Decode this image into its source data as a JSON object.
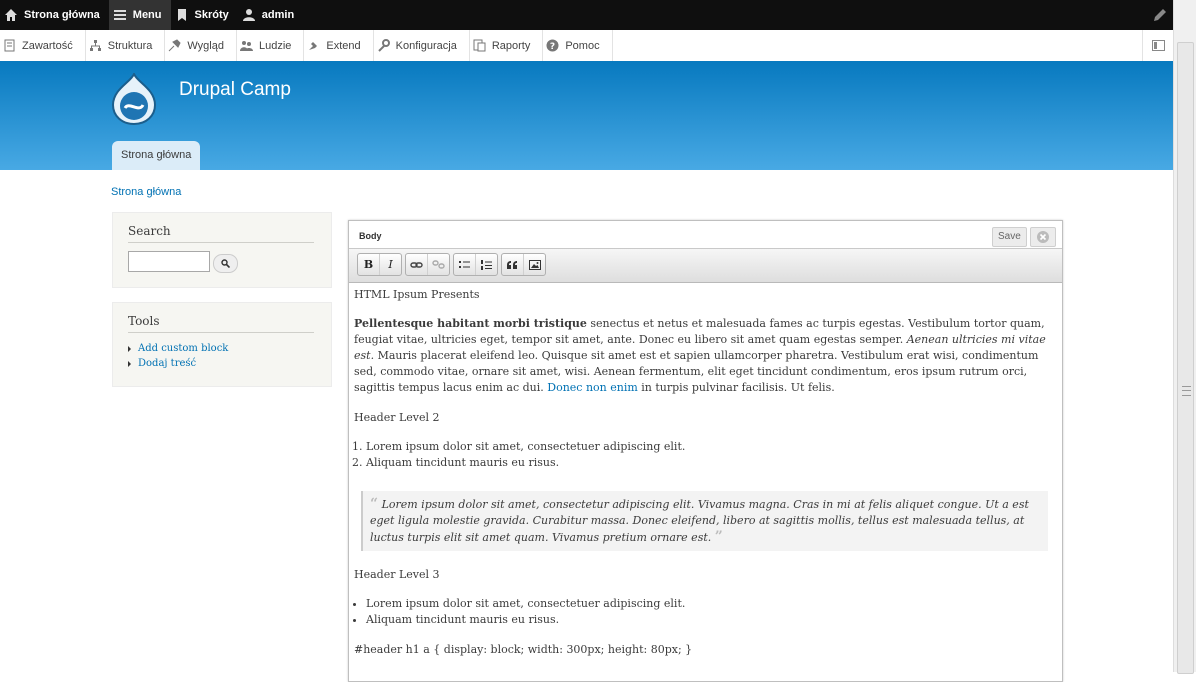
{
  "toolbar": {
    "home": "Strona główna",
    "menu": "Menu",
    "shortcuts": "Skróty",
    "user": "admin"
  },
  "tray": {
    "items": [
      "Zawartość",
      "Struktura",
      "Wygląd",
      "Ludzie",
      "Extend",
      "Konfiguracja",
      "Raporty",
      "Pomoc"
    ]
  },
  "site": {
    "name": "Drupal Camp",
    "tab": "Strona główna"
  },
  "breadcrumb": "Strona główna",
  "sidebar": {
    "search_title": "Search",
    "tools_title": "Tools",
    "tools_links": [
      "Add custom block",
      "Dodaj treść"
    ]
  },
  "editor": {
    "field_label": "Body",
    "save_label": "Save",
    "toolbar_buttons": [
      "B",
      "I"
    ],
    "content": {
      "p1": "HTML Ipsum Presents",
      "p2_bold": "Pellentesque habitant morbi tristique",
      "p2_text1": " senectus et netus et malesuada fames ac turpis egestas. Vestibulum tortor quam, feugiat vitae, ultricies eget, tempor sit amet, ante. Donec eu libero sit amet quam egestas semper. ",
      "p2_italic": "Aenean ultricies mi vitae est.",
      "p2_text2": " Mauris placerat eleifend leo. Quisque sit amet est et sapien ullamcorper pharetra. Vestibulum erat wisi, condimentum sed, commodo vitae, ornare sit amet, wisi. Aenean fermentum, elit eget tincidunt condimentum, eros ipsum rutrum orci, sagittis tempus lacus enim ac dui. ",
      "p2_link": "Donec non enim",
      "p2_text3": " in turpis pulvinar facilisis. Ut felis.",
      "h2": "Header Level 2",
      "ol": [
        "Lorem ipsum dolor sit amet, consectetuer adipiscing elit.",
        "Aliquam tincidunt mauris eu risus."
      ],
      "quote": "Lorem ipsum dolor sit amet, consectetur adipiscing elit. Vivamus magna. Cras in mi at felis aliquet congue. Ut a est eget ligula molestie gravida. Curabitur massa. Donec eleifend, libero at sagittis mollis, tellus est malesuada tellus, at luctus turpis elit sit amet quam. Vivamus pretium ornare est.",
      "h3": "Header Level 3",
      "ul": [
        "Lorem ipsum dolor sit amet, consectetuer adipiscing elit.",
        "Aliquam tincidunt mauris eu risus."
      ],
      "code": "#header h1 a { display: block; width: 300px; height: 80px; }"
    }
  },
  "colors": {
    "toolbar_bg": "#0f0f0f",
    "header_top": "#0779bf",
    "header_bottom": "#48a9e4",
    "link": "#0071b3"
  },
  "icons": [
    "home-icon",
    "menu-icon",
    "bookmark-icon",
    "user-icon",
    "pencil-icon",
    "content-icon",
    "structure-icon",
    "appearance-icon",
    "people-icon",
    "extend-icon",
    "config-icon",
    "reports-icon",
    "help-icon",
    "search-icon",
    "close-icon",
    "link-icon",
    "unlink-icon",
    "bullet-list-icon",
    "numbered-list-icon",
    "blockquote-icon",
    "image-icon"
  ]
}
